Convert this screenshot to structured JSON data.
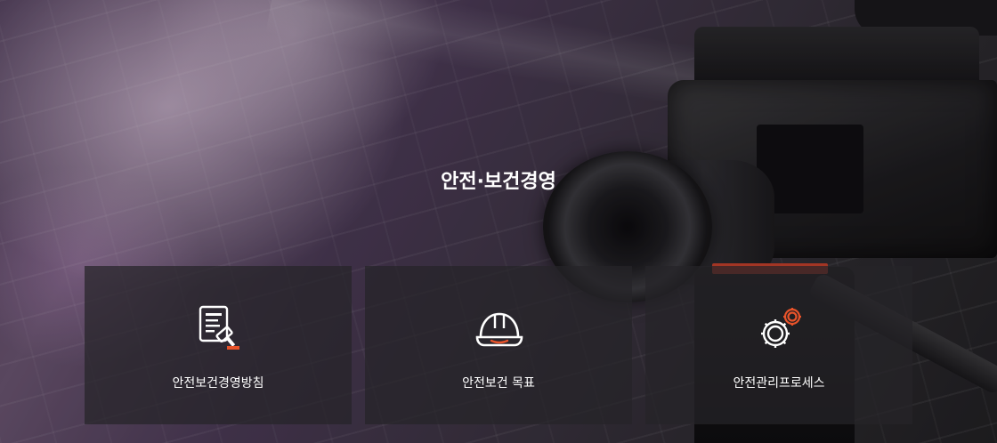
{
  "section": {
    "title": "안전·보건경영"
  },
  "cards": [
    {
      "label": "안전보건경영방침",
      "icon": "document-gavel-icon"
    },
    {
      "label": "안전보건 목표",
      "icon": "hard-hat-icon"
    },
    {
      "label": "안전관리프로세스",
      "icon": "gears-icon"
    }
  ],
  "colors": {
    "accent": "#e8532a",
    "card_bg": "rgba(38,36,40,0.72)",
    "text": "#ffffff"
  }
}
